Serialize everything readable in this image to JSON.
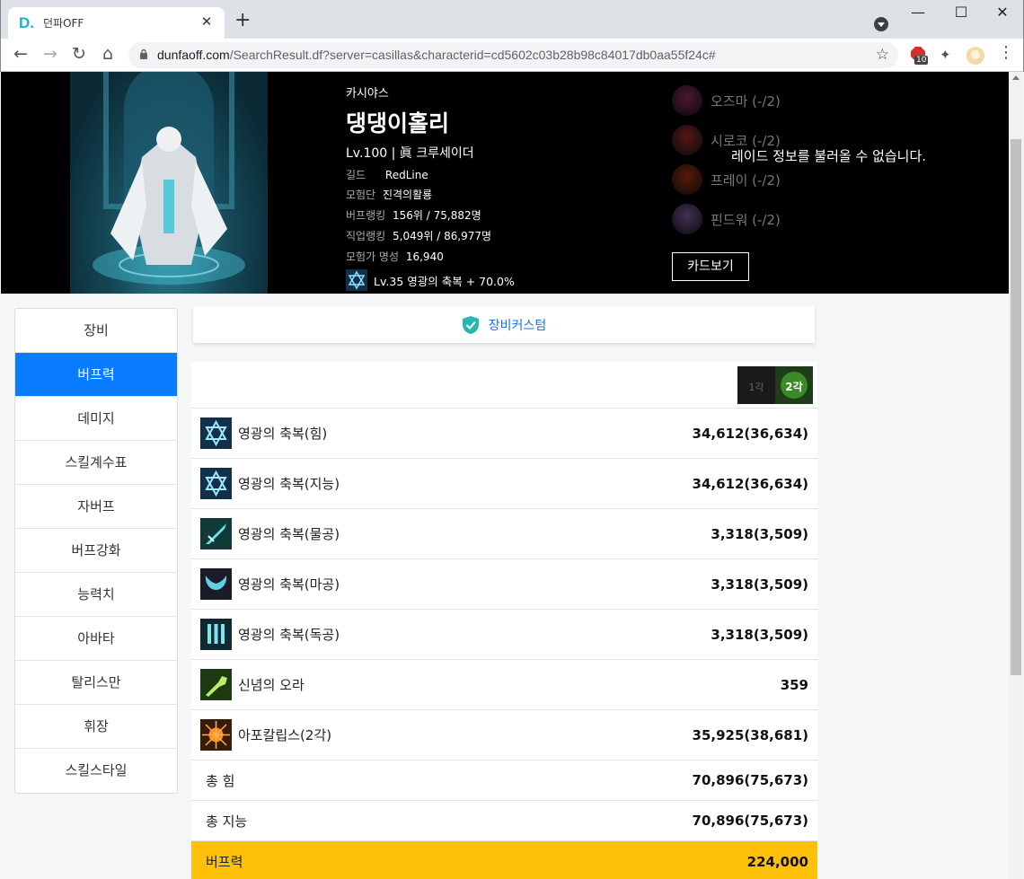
{
  "browser": {
    "tab_title": "던파OFF",
    "tab_favicon": "D.",
    "url_host": "dunfaoff.com",
    "url_path": "/SearchResult.df?server=casillas&characterid=cd5602c03b28b98c84017db0aa55f24c#",
    "ext_badge": "10",
    "icons": [
      "back-icon",
      "forward-icon",
      "reload-icon",
      "home-icon",
      "lock-icon",
      "star-icon",
      "puzzle-icon",
      "kebab-menu-icon"
    ]
  },
  "character": {
    "server": "카시야스",
    "name": "댕댕이홀리",
    "level_line": "Lv.100 | 眞 크루세이더",
    "guild_label": "길드",
    "guild": "RedLine",
    "adventure_label": "모험단",
    "adventure": "진격의활룡",
    "buff_rank_label": "버프랭킹",
    "buff_rank": "156위 / 75,882명",
    "job_rank_label": "직업랭킹",
    "job_rank": "5,049위 / 86,977명",
    "fame_label": "모험가 명성",
    "fame": "16,940",
    "buff_skill": "Lv.35 영광의 축복 + 70.0%"
  },
  "raids": [
    {
      "name": "오즈마 (-/2)",
      "color": "#8a2a5a"
    },
    {
      "name": "시로코 (-/2)",
      "color": "#9a2a2a"
    },
    {
      "name": "프레이 (-/2)",
      "color": "#a03010"
    },
    {
      "name": "핀드워 (-/2)",
      "color": "#7a5a9a"
    }
  ],
  "raid_message": "레이드 정보를 불러올 수 없습니다.",
  "card_button": "카드보기",
  "nav": [
    "장비",
    "버프력",
    "데미지",
    "스킬계수표",
    "자버프",
    "버프강화",
    "능력치",
    "아바타",
    "탈리스만",
    "휘장",
    "스킬스타일"
  ],
  "active_nav": 1,
  "custom_label": "장비커스텀",
  "head_icon_text": "2각",
  "rows": [
    {
      "name": "영광의 축복(힘)",
      "value": "34,612(36,634)",
      "icon": "star-of-david-icon"
    },
    {
      "name": "영광의 축복(지능)",
      "value": "34,612(36,634)",
      "icon": "star-of-david-icon"
    },
    {
      "name": "영광의 축복(물공)",
      "value": "3,318(3,509)",
      "icon": "sword-icon"
    },
    {
      "name": "영광의 축복(마공)",
      "value": "3,318(3,509)",
      "icon": "wings-icon"
    },
    {
      "name": "영광의 축복(독공)",
      "value": "3,318(3,509)",
      "icon": "pillars-icon"
    },
    {
      "name": "신념의 오라",
      "value": "359",
      "icon": "fist-icon"
    },
    {
      "name": "아포칼립스(2각)",
      "value": "35,925(38,681)",
      "icon": "burst-icon"
    }
  ],
  "totals": [
    {
      "name": "총 힘",
      "value": "70,896(75,673)"
    },
    {
      "name": "총 지능",
      "value": "70,896(75,673)"
    }
  ],
  "buff_power": {
    "name": "버프력",
    "value": "224,000"
  },
  "colors": {
    "accent": "#0a7cff",
    "highlight": "#ffc107",
    "link": "#1a73e8",
    "teal": "#18b3c7"
  }
}
